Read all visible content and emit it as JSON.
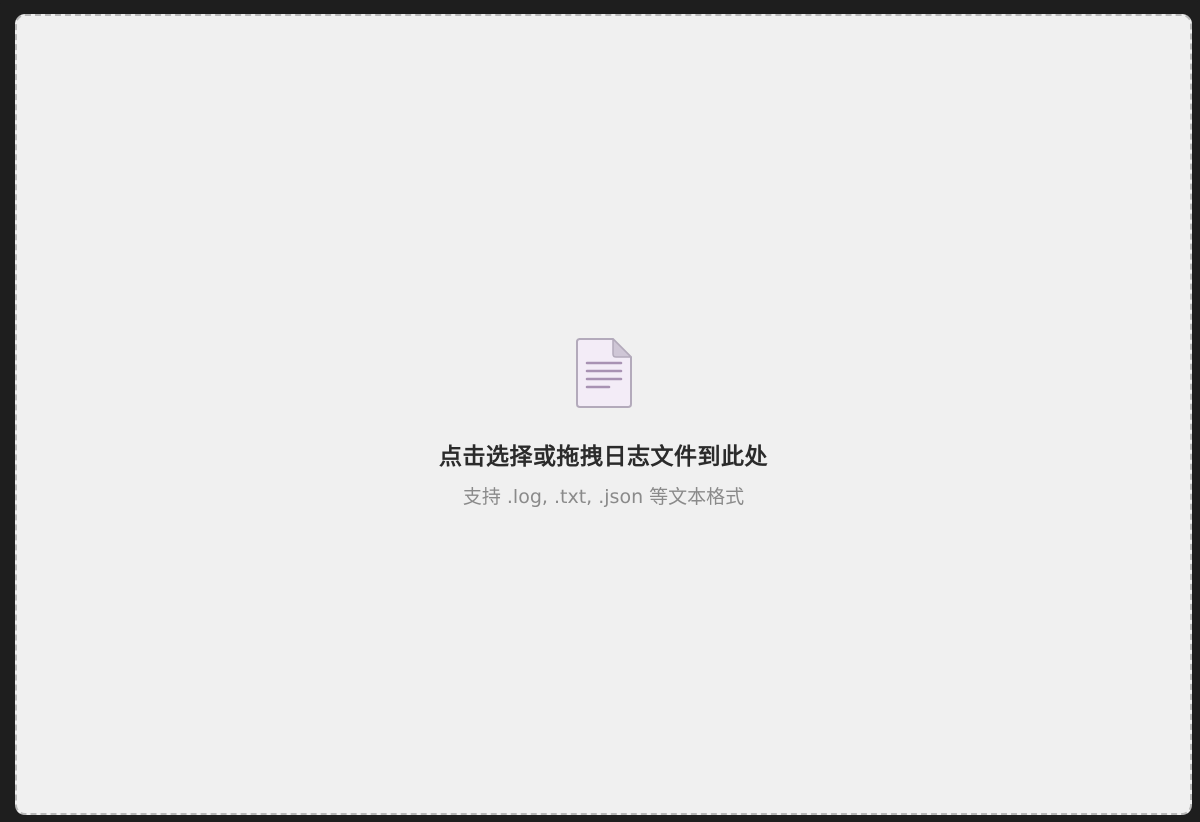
{
  "dropzone": {
    "icon": "document-icon",
    "title": "点击选择或拖拽日志文件到此处",
    "subtitle": "支持 .log, .txt, .json 等文本格式"
  },
  "colors": {
    "background": "#1e1e1e",
    "dropzone_fill": "#f0f0f0",
    "dropzone_border": "#b9b9b9",
    "icon_fill": "#f3ecf7",
    "icon_stroke": "#b3aabb",
    "icon_lines": "#a892b3"
  }
}
